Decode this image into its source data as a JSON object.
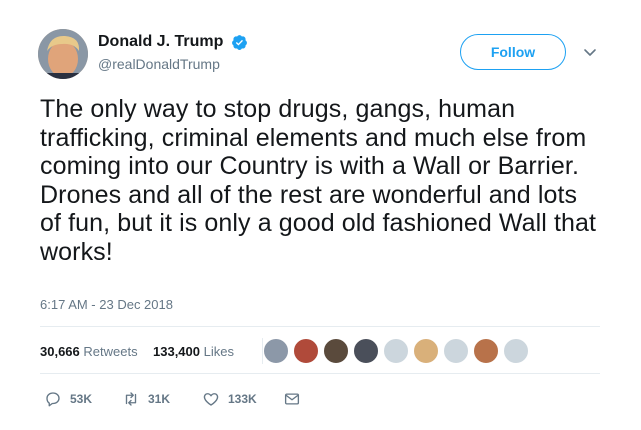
{
  "author": {
    "display_name": "Donald J. Trump",
    "handle": "@realDonaldTrump",
    "verified": true
  },
  "follow_label": "Follow",
  "tweet_text": "The only way to stop drugs, gangs, human trafficking, criminal elements and much else from coming into our Country is with a Wall or Barrier. Drones and all of the rest are wonderful and lots of fun, but it is only a good old fashioned Wall that works!",
  "timestamp": "6:17 AM - 23 Dec 2018",
  "stats": {
    "retweets_count": "30,666",
    "retweets_label": "Retweets",
    "likes_count": "133,400",
    "likes_label": "Likes"
  },
  "actions": {
    "reply_count": "53K",
    "retweet_count": "31K",
    "like_count": "133K"
  },
  "colors": {
    "accent": "#1da1f2",
    "text": "#14171a",
    "secondary": "#657786",
    "divider": "#e6ecf0"
  },
  "icons": [
    "verified-badge-icon",
    "chevron-down-icon",
    "reply-icon",
    "retweet-icon",
    "heart-icon",
    "direct-message-icon"
  ]
}
